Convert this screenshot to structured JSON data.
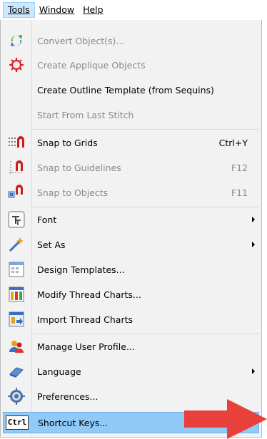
{
  "menubar": {
    "tools": "Tools",
    "window": "Window",
    "help": "Help"
  },
  "menu": {
    "items": [
      {
        "label": "Convert Object(s)...",
        "icon": "convert-icon",
        "disabled": true
      },
      {
        "label": "Create Applique Objects",
        "icon": "applique-icon",
        "disabled": true
      },
      {
        "label": "Create Outline Template (from Sequins)",
        "disabled": false
      },
      {
        "label": "Start From Last Stitch",
        "disabled": true
      },
      {
        "label": "Snap to Grids",
        "shortcut": "Ctrl+Y",
        "icon": "snap-grid-icon",
        "disabled": false
      },
      {
        "label": "Snap to Guidelines",
        "shortcut": "F12",
        "icon": "snap-guidelines-icon",
        "disabled": true
      },
      {
        "label": "Snap to Objects",
        "shortcut": "F11",
        "icon": "snap-objects-icon",
        "disabled": true
      },
      {
        "label": "Font",
        "icon": "font-icon",
        "submenu": true
      },
      {
        "label": "Set As",
        "icon": "set-as-icon",
        "submenu": true
      },
      {
        "label": "Design Templates...",
        "icon": "design-templates-icon"
      },
      {
        "label": "Modify Thread Charts...",
        "icon": "modify-thread-charts-icon"
      },
      {
        "label": "Import Thread Charts",
        "icon": "import-thread-charts-icon"
      },
      {
        "label": "Manage User Profile...",
        "icon": "user-profile-icon"
      },
      {
        "label": "Language",
        "icon": "language-icon",
        "submenu": true
      },
      {
        "label": "Preferences...",
        "icon": "preferences-icon"
      },
      {
        "label": "Shortcut Keys...",
        "icon": "ctrl-key-icon",
        "icon_text": "Ctrl",
        "highlighted": true
      }
    ]
  },
  "annotation": {
    "arrow_color": "#e8403a"
  },
  "colors": {
    "highlight": "#91c9f7",
    "menu_bg": "#f2f2f2"
  }
}
